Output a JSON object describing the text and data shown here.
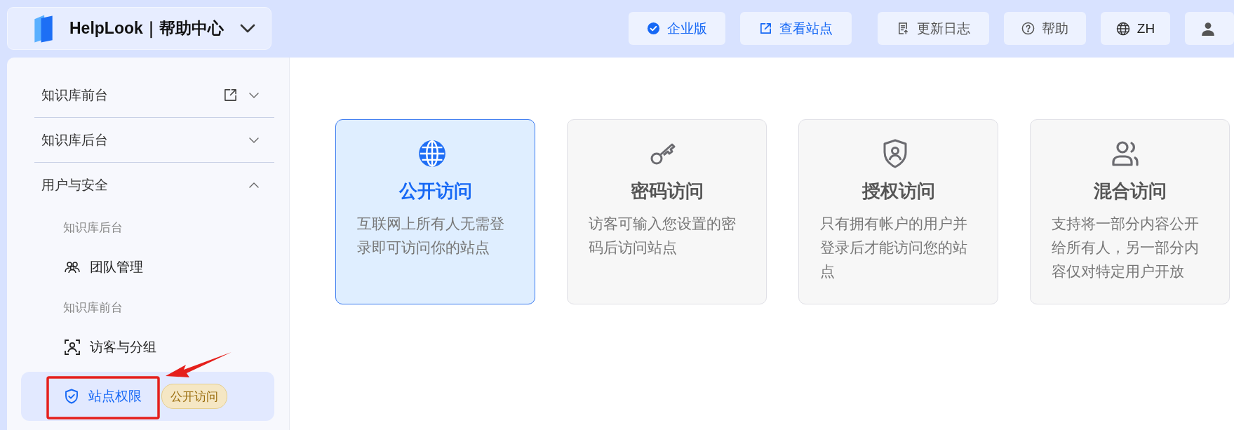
{
  "header": {
    "brand": "HelpLook｜帮助中心",
    "buttons": [
      {
        "label": "企业版",
        "kind": "plan"
      },
      {
        "label": "查看站点",
        "kind": "site"
      },
      {
        "label": "更新日志",
        "kind": "changelog"
      },
      {
        "label": "帮助",
        "kind": "help"
      },
      {
        "label": "ZH",
        "kind": "language"
      },
      {
        "kind": "account"
      }
    ]
  },
  "sidebar": {
    "items": [
      {
        "label": "知识库前台",
        "kind": "section",
        "external": true,
        "expanded": false
      },
      {
        "label": "知识库后台",
        "kind": "section",
        "expanded": false
      },
      {
        "label": "用户与安全",
        "kind": "section",
        "expanded": true,
        "children": [
          {
            "label": "知识库后台",
            "kind": "group"
          },
          {
            "label": "团队管理",
            "kind": "team",
            "selected": false
          },
          {
            "label": "知识库前台",
            "kind": "group"
          },
          {
            "label": "访客与分组",
            "kind": "visitors",
            "selected": false
          },
          {
            "label": "站点权限",
            "kind": "permissions",
            "selected": true,
            "badge": "公开访问"
          }
        ]
      }
    ]
  },
  "access_modes": [
    {
      "kind": "public",
      "title": "公开访问",
      "description": "互联网上所有人无需登录即可访问你的站点",
      "selected": true
    },
    {
      "kind": "password",
      "title": "密码访问",
      "description": "访客可输入您设置的密码后访问站点",
      "selected": false
    },
    {
      "kind": "authorized",
      "title": "授权访问",
      "description": "只有拥有帐户的用户并登录后才能访问您的站点",
      "selected": false
    },
    {
      "kind": "mixed",
      "title": "混合访问",
      "description": "支持将一部分内容公开给所有人，另一部分内容仅对特定用户开放",
      "selected": false
    }
  ]
}
